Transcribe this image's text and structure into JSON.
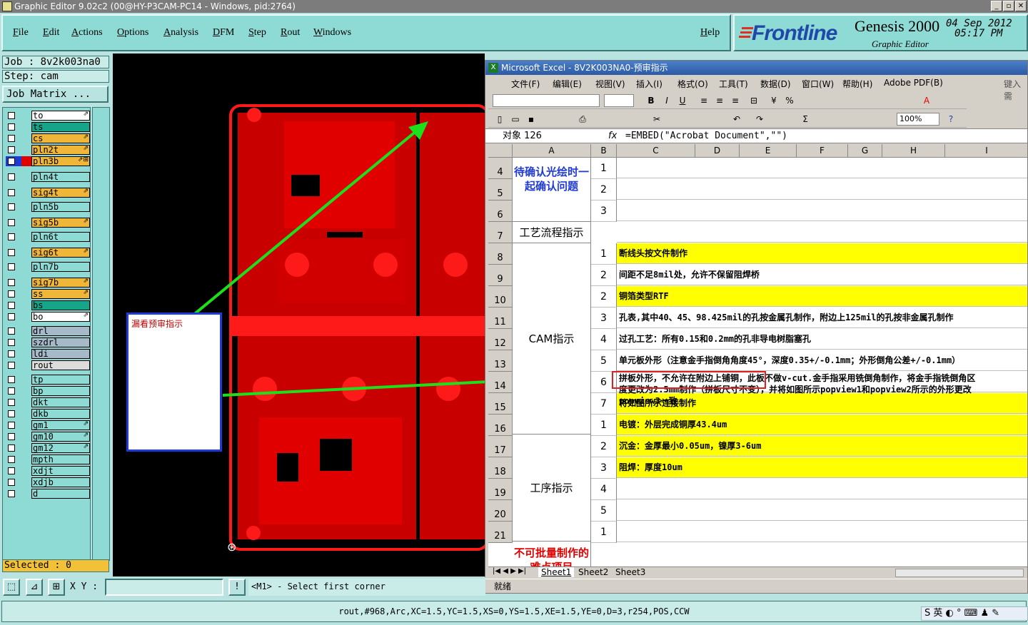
{
  "title_bar": {
    "text": "Graphic Editor 9.02c2 (00@HY-P3CAM-PC14 - Windows, pid:2764)"
  },
  "menu": [
    "File",
    "Edit",
    "Actions",
    "Options",
    "Analysis",
    "DFM",
    "Step",
    "Rout",
    "Windows"
  ],
  "help_label": "Help",
  "brand": {
    "logo": "Frontline",
    "app": "Genesis 2000",
    "subtitle": "Graphic Editor",
    "date": "04 Sep 2012",
    "time": "05:17 PM"
  },
  "job": "Job : 8v2k003na0",
  "step": "Step: cam",
  "job_matrix": "Job Matrix ...",
  "layers": [
    {
      "name": "to",
      "color": "#ffffff",
      "mark": "⇗"
    },
    {
      "name": "ts",
      "color": "#17a589",
      "mark": ""
    },
    {
      "name": "cs",
      "color": "#f0b63a",
      "mark": "⇗"
    },
    {
      "name": "pln2t",
      "color": "#f0b63a",
      "mark": "⇗"
    },
    {
      "name": "pln3b",
      "color": "#f0b63a",
      "mark": "⇗⊞"
    },
    {
      "name": "pln4t",
      "color": "#8edad4",
      "mark": ""
    },
    {
      "name": "sig4t",
      "color": "#f0b63a",
      "mark": "⇗"
    },
    {
      "name": "pln5b",
      "color": "#8edad4",
      "mark": ""
    },
    {
      "name": "sig5b",
      "color": "#f0b63a",
      "mark": "⇗"
    },
    {
      "name": "pln6t",
      "color": "#8edad4",
      "mark": ""
    },
    {
      "name": "sig6t",
      "color": "#f0b63a",
      "mark": "⇗"
    },
    {
      "name": "pln7b",
      "color": "#8edad4",
      "mark": ""
    },
    {
      "name": "sig7b",
      "color": "#f0b63a",
      "mark": "⇗"
    },
    {
      "name": "ss",
      "color": "#f0b63a",
      "mark": "⇗"
    },
    {
      "name": "bs",
      "color": "#17a589",
      "mark": ""
    },
    {
      "name": "bo",
      "color": "#ffffff",
      "mark": "⇗"
    },
    {
      "name": "drl",
      "color": "#a6b9c8",
      "mark": ""
    },
    {
      "name": "szdrl",
      "color": "#a6b9c8",
      "mark": ""
    },
    {
      "name": "ldi",
      "color": "#a6b9c8",
      "mark": ""
    },
    {
      "name": "rout",
      "color": "#dcdcdc",
      "mark": ""
    },
    {
      "name": "tp",
      "color": "#8edad4",
      "mark": ""
    },
    {
      "name": "bp",
      "color": "#8edad4",
      "mark": ""
    },
    {
      "name": "dkt",
      "color": "#8edad4",
      "mark": ""
    },
    {
      "name": "dkb",
      "color": "#8edad4",
      "mark": ""
    },
    {
      "name": "gm1",
      "color": "#8edad4",
      "mark": "⇗"
    },
    {
      "name": "gm10",
      "color": "#8edad4",
      "mark": "⇗"
    },
    {
      "name": "gm12",
      "color": "#8edad4",
      "mark": "⇗"
    },
    {
      "name": "mpth",
      "color": "#8edad4",
      "mark": ""
    },
    {
      "name": "xdjt",
      "color": "#8edad4",
      "mark": ""
    },
    {
      "name": "xdjb",
      "color": "#8edad4",
      "mark": ""
    },
    {
      "name": "d",
      "color": "#8edad4",
      "mark": ""
    }
  ],
  "selected": "Selected : 0",
  "note_box": "漏看预审指示",
  "xy_label": "X Y :",
  "prompt": "<M1> - Select first corner",
  "status_line": "rout,#968,Arc,XC=1.5,YC=1.5,XS=0,YS=1.5,XE=1.5,YE=0,D=3,r254,POS,CCW",
  "tray": "S 英 ◐ ° ⌨ ♟ ✎",
  "excel": {
    "title": "Microsoft Excel - 8V2K003NA0-预审指示",
    "menu": [
      "文件(F)",
      "编辑(E)",
      "视图(V)",
      "插入(I)",
      "格式(O)",
      "工具(T)",
      "数据(D)",
      "窗口(W)",
      "帮助(H)",
      "Adobe PDF(B)"
    ],
    "help_hint": "键入需",
    "zoom": "100%",
    "namebox": "对象 126",
    "formula": "=EMBED(\"Acrobat Document\",\"\")",
    "columns": [
      "A",
      "B",
      "C",
      "D",
      "E",
      "F",
      "G",
      "H",
      "I"
    ],
    "rows": [
      {
        "row": "4",
        "num": "1",
        "text": "",
        "yellow": false
      },
      {
        "row": "5",
        "num": "2",
        "text": "",
        "yellow": false
      },
      {
        "row": "6",
        "num": "3",
        "text": "",
        "yellow": false
      },
      {
        "row": "7",
        "num": "",
        "text": "",
        "yellow": false
      },
      {
        "row": "8",
        "num": "1",
        "text": "断线头按文件制作",
        "yellow": true
      },
      {
        "row": "9",
        "num": "2",
        "text": "间距不足8mil处，允许不保留阻焊桥",
        "yellow": false
      },
      {
        "row": "10",
        "num": "2",
        "text": "铜箔类型RTF",
        "yellow": true
      },
      {
        "row": "11",
        "num": "3",
        "text": "孔表,其中40、45、98.425mil的孔按金属孔制作，附边上125mil的孔按非金属孔制作",
        "yellow": false
      },
      {
        "row": "12",
        "num": "4",
        "text": "过孔工艺：所有0.15和0.2mm的孔非导电树脂塞孔",
        "yellow": false
      },
      {
        "row": "13",
        "num": "5",
        "text": "单元板外形（注意金手指倒角角度45°，深度0.35+/-0.1mm；外形倒角公差+/-0.1mm）",
        "yellow": false
      },
      {
        "row": "14",
        "num": "6",
        "text": "",
        "yellow": false
      },
      {
        "row": "15",
        "num": "7",
        "text": "将如图所示连接制作",
        "yellow": true
      },
      {
        "row": "16",
        "num": "1",
        "text": "电镀：外层完成铜厚43.4um",
        "yellow": true
      },
      {
        "row": "17",
        "num": "2",
        "text": "沉金：金厚最小0.05um，镍厚3-6um",
        "yellow": true
      },
      {
        "row": "18",
        "num": "3",
        "text": "阻焊：厚度10um",
        "yellow": true
      },
      {
        "row": "19",
        "num": "4",
        "text": "",
        "yellow": false
      },
      {
        "row": "20",
        "num": "5",
        "text": "",
        "yellow": false
      },
      {
        "row": "21",
        "num": "1",
        "text": "",
        "yellow": false
      }
    ],
    "row14_lines": [
      "拼板外形，不允许在附边上铺铜，此板不做v-cut.金手指采用铣倒角制作，将金手指铣倒角区",
      "度更改为2.5mm制作（拼板尺寸不变），并将如图所示popview1和popview2所示的外形更改",
      "popview3一致"
    ],
    "group_a": {
      "confirm": "待确认光绘时一起确认问题",
      "process": "工艺流程指示",
      "cam": "CAM指示",
      "procedure": "工序指示",
      "batch": "不可批量制作的难点项目"
    },
    "sheets": [
      "Sheet1",
      "Sheet2",
      "Sheet3"
    ],
    "status": "就绪"
  }
}
